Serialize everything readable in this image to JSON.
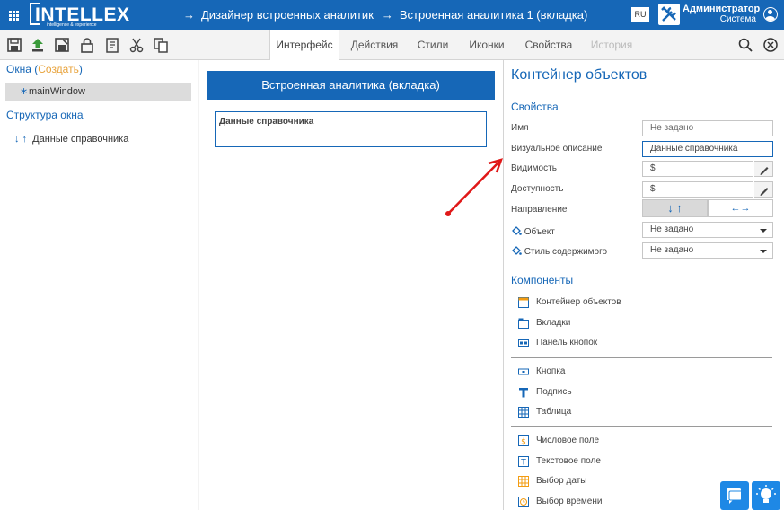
{
  "header": {
    "logo": "INTELLEX",
    "logo_sub": "intelligence & experience",
    "crumb1": "Дизайнер встроенных аналитик",
    "crumb2": "Встроенная аналитика 1 (вкладка)",
    "lang": "RU",
    "user_name": "Администратор",
    "user_role": "Система"
  },
  "tabs": [
    {
      "label": "Интерфейс"
    },
    {
      "label": "Действия"
    },
    {
      "label": "Стили"
    },
    {
      "label": "Иконки"
    },
    {
      "label": "Свойства"
    },
    {
      "label": "История"
    }
  ],
  "left": {
    "windows_label": "Окна",
    "create_label": "Создать",
    "window_item": "mainWindow",
    "structure_label": "Структура окна",
    "structure_item": "Данные справочника"
  },
  "canvas": {
    "banner": "Встроенная аналитика (вкладка)",
    "container_label": "Данные справочника"
  },
  "props": {
    "title": "Контейнер объектов",
    "section": "Свойства",
    "name_label": "Имя",
    "name_value": "Не задано",
    "visual_label": "Визуальное описание",
    "visual_value": "Данные справочника",
    "visibility_label": "Видимость",
    "visibility_value": "$",
    "access_label": "Доступность",
    "access_value": "$",
    "direction_label": "Направление",
    "dir_vertical": "↓ ↑",
    "dir_horizontal": "←→",
    "object_label": "Объект",
    "object_value": "Не задано",
    "style_label": "Стиль содержимого",
    "style_value": "Не задано"
  },
  "components": {
    "title": "Компоненты",
    "group1": [
      "Контейнер объектов",
      "Вкладки",
      "Панель кнопок"
    ],
    "group2": [
      "Кнопка",
      "Подпись",
      "Таблица"
    ],
    "group3": [
      "Числовое поле",
      "Текстовое поле",
      "Выбор даты",
      "Выбор времени"
    ]
  },
  "colors": {
    "brand": "#1667b7",
    "accent": "#e8a33c",
    "arrow": "#e01818"
  }
}
